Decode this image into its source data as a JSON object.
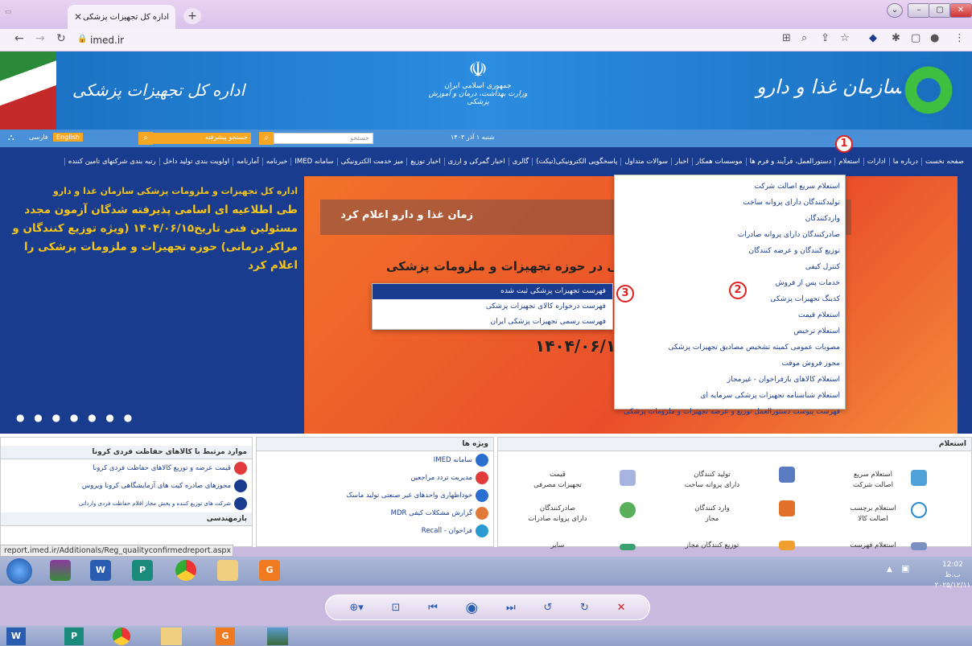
{
  "browser": {
    "tab_title": "اداره کل تجهیزات پزشکی",
    "tab_close": "✕",
    "new_tab": "+",
    "url": "imed.ir"
  },
  "header": {
    "left_title": "اداره کل تجهیزات پزشکی",
    "mid_line1": "جمهوری اسلامی ایران",
    "mid_line2": "وزارت بهداشت، درمان و آموزش پزشکی",
    "right_title": "سازمان غذا و دارو"
  },
  "infobar": {
    "date": "شنبه ۱ آذر ۱۴۰۳",
    "search_placeholder": "جستجو",
    "advanced_search": "جستجو پیشرفته",
    "lang_en": "English",
    "lang_fa": "فارسی"
  },
  "menu": [
    "صفحه نخست",
    "درباره ما",
    "ادارات",
    "استعلام",
    "دستورالعمل، فرآیند و فرم ها",
    "موسسات همکار",
    "اخبار",
    "سوالات متداول",
    "پاسخگویی الکترونیکی(تیکت)",
    "گالری",
    "اخبار گمرکی و ارزی",
    "اخبار توزیع",
    "میز خدمت الکترونیکی",
    "سامانه IMED",
    "خبرنامه",
    "آمارنامه",
    "اولویت بندی تولید داخل",
    "رتبه بندی شرکتهای تامین کننده"
  ],
  "left_panel": {
    "title": "اداره کل تجهیزات و ملزومات پزشکی سازمان غذا و دارو",
    "body": "طی اطلاعیه ای اسامی پذیرفته شدگان آزمون مجدد مسئولین فنی تاریخ۱۴۰۴/۰۶/۱۵ (ویژه توزیع کنندگان و مراکز درمانی) حوزه تجهیزات و ملزومات پزشکی را اعلام کرد"
  },
  "slider": {
    "banner": "زمان غذا و دارو اعلام کرد",
    "head": "ن فنی در حوزه تجهیزات و ملزومات پزشکی",
    "date": "۱۴۰۴/۰۶/۱۵",
    "dots": "● ● ● ● ● ● ●"
  },
  "dropdown_main": [
    "استعلام سریع اصالت شرکت",
    "تولیدکنندگان دارای پروانه ساخت",
    "واردکنندگان",
    "صادرکنندگان دارای پروانه صادرات",
    "توزیع کنندگان و عرضه کنندگان",
    "کنترل کیفی",
    "خدمات پس از فروش",
    "کدینگ تجهیزات پزشکی",
    "استعلام قیمت",
    "استعلام ترخیص",
    "مصوبات عمومی کمیته تشخیص مصادیق تجهیزات پزشکی",
    "مجوز فروش موقت",
    "استعلام کالاهای بازفراخوان - غیرمجاز",
    "استعلام شناسنامه تجهیزات پزشکی سرمایه ای",
    "فهرست پیوست دستورالعمل توزیع و عرضه تجهیزات و ملزومات پزشکی"
  ],
  "dropdown_sub": [
    "فهرست تجهیزات پزشکی ثبت شده",
    "فهرست درخواره کالای تجهیزات پزشکی",
    "فهرست رسمی تجهیزات پزشکی ایران"
  ],
  "annotations": [
    "1",
    "2",
    "3"
  ],
  "panels": {
    "inquiry": {
      "title": "استعلام",
      "cells": [
        {
          "l1": "استعلام سریع",
          "l2": "اصالت شرکت"
        },
        {
          "l1": "تولید کنندگان",
          "l2": "دارای پروانه ساخت"
        },
        {
          "l1": "قیمت",
          "l2": "تجهیزات مصرفی"
        },
        {
          "l1": "استعلام برچسب",
          "l2": "اصالت کالا"
        },
        {
          "l1": "وارد کنندگان",
          "l2": "مجاز"
        },
        {
          "l1": "صادرکنندگان",
          "l2": "دارای پروانه صادرات"
        },
        {
          "l1": "استعلام فهرست",
          "l2": ""
        },
        {
          "l1": "توزیع کنندگان مجاز",
          "l2": ""
        },
        {
          "l1": "سایر",
          "l2": ""
        }
      ]
    },
    "special": {
      "title": "ویژه ها",
      "items": [
        "سامانه IMED",
        "مدیریت تردد مراجعین",
        "خوداظهاری واحدهای غیر صنعتی تولید ماسک",
        "گزارش مشکلات کیفی MDR",
        "فراخوان - Recall"
      ]
    },
    "corona": {
      "title": "موارد مرتبط با کالاهای حفاظت فردی کرونا",
      "items": [
        "قیمت عرضه و توزیع کالاهای حفاظت فردی کرونا",
        "مجوزهای صادره کیت های آزمایشگاهی کرونا ویروس",
        "شرکت های توزیع کننده و پخش مجاز اقلام حفاظت فردی وارداتی"
      ],
      "sub_title": "بازمهندسی"
    }
  },
  "status_url": "report.imed.ir/Additionals/Reg_qualityconfirmedreport.aspx",
  "taskbar": {
    "time": "12:02 ب.ظ",
    "date": "۲۰۲۵/۱۲/۱۱"
  },
  "colors": {
    "header_blue": "#1a6fc0",
    "menu_navy": "#1a3c8f",
    "accent_orange": "#f5a623",
    "annotation_red": "#e02020",
    "headline_yellow": "#f5c518"
  }
}
